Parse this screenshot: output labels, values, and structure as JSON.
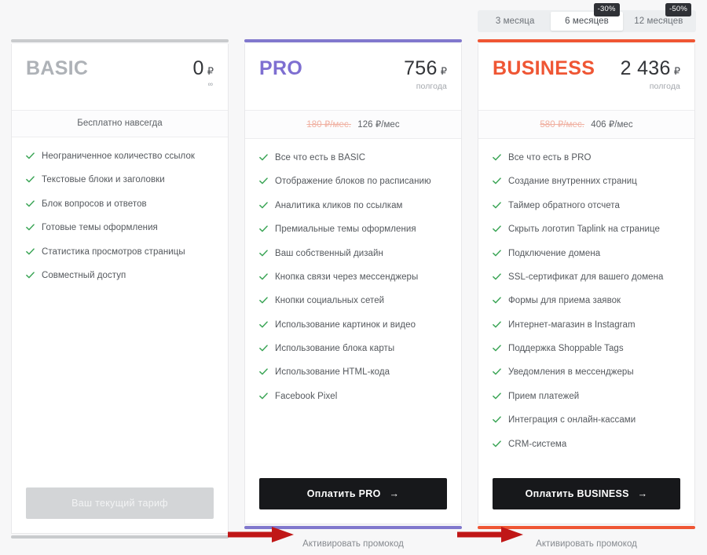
{
  "period_switcher": {
    "tabs": [
      {
        "label": "3 месяца",
        "badge": "",
        "selected": false
      },
      {
        "label": "6 месяцев",
        "badge": "-30%",
        "selected": true
      },
      {
        "label": "12 месяцев",
        "badge": "-50%",
        "selected": false
      }
    ]
  },
  "colors": {
    "basic_accent": "#c9cbcd",
    "pro_accent": "#8178cd",
    "business_accent": "#ef5634",
    "badge_bg": "#2f3136",
    "check_green": "#3ba556",
    "cta_dark": "#17181b",
    "cta_disabled": "#d3d5d7",
    "annotation_arrow": "#c01717"
  },
  "plans": [
    {
      "name": "BASIC",
      "price_amount": "0",
      "price_currency": "₽",
      "price_period": "",
      "price_infinity": "∞",
      "subprice_old": "",
      "subprice_new": "Бесплатно навсегда",
      "features": [
        "Неограниченное количество ссылок",
        "Текстовые блоки и заголовки",
        "Блок вопросов и ответов",
        "Готовые темы оформления",
        "Статистика просмотров страницы",
        "Совместный доступ"
      ],
      "cta_label": "Ваш текущий тариф",
      "cta_arrow": "",
      "cta_disabled": true,
      "promo_label": ""
    },
    {
      "name": "PRO",
      "price_amount": "756",
      "price_currency": "₽",
      "price_period": "полгода",
      "price_infinity": "",
      "subprice_old": "180 ₽/мес.",
      "subprice_new": "126 ₽/мес",
      "features": [
        "Все что есть в BASIC",
        "Отображение блоков по расписанию",
        "Аналитика кликов по ссылкам",
        "Премиальные темы оформления",
        "Ваш собственный дизайн",
        "Кнопка связи через мессенджеры",
        "Кнопки социальных сетей",
        "Использование картинок и видео",
        "Использование блока карты",
        "Использование HTML-кода",
        "Facebook Pixel"
      ],
      "cta_label": "Оплатить PRO",
      "cta_arrow": "→",
      "cta_disabled": false,
      "promo_label": "Активировать промокод"
    },
    {
      "name": "BUSINESS",
      "price_amount": "2 436",
      "price_currency": "₽",
      "price_period": "полгода",
      "price_infinity": "",
      "subprice_old": "580 ₽/мес.",
      "subprice_new": "406 ₽/мес",
      "features": [
        "Все что есть в PRO",
        "Создание внутренних страниц",
        "Таймер обратного отсчета",
        "Скрыть логотип Taplink на странице",
        "Подключение домена",
        "SSL-сертификат для вашего домена",
        "Формы для приема заявок",
        "Интернет-магазин в Instagram",
        "Поддержка Shoppable Tags",
        "Уведомления в мессенджеры",
        "Прием платежей",
        "Интеграция с онлайн-кассами",
        "CRM-система"
      ],
      "cta_label": "Оплатить BUSINESS",
      "cta_arrow": "→",
      "cta_disabled": false,
      "promo_label": "Активировать промокод"
    }
  ]
}
